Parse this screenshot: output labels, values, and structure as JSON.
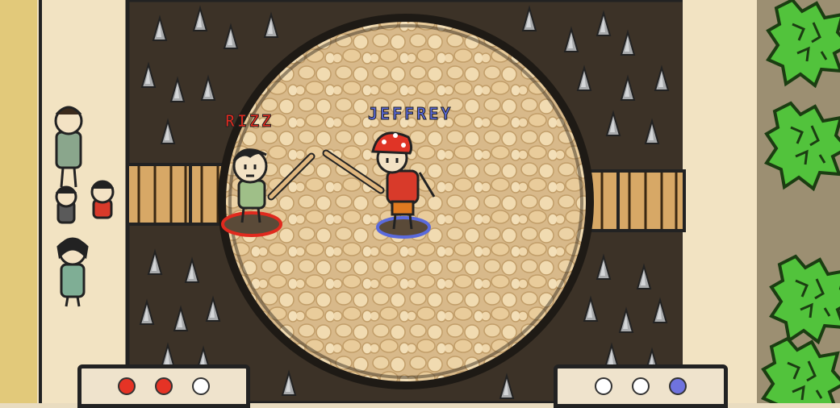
{
  "fighters": {
    "left": {
      "name": "RIZZ",
      "color": "#e02a1e"
    },
    "right": {
      "name": "JEFFREY",
      "color": "#5a6adc"
    }
  },
  "score_left": {
    "dots": [
      "#e53325",
      "#e53325",
      "#ffffff"
    ]
  },
  "score_right": {
    "dots": [
      "#ffffff",
      "#ffffff",
      "#6f73de"
    ]
  },
  "colors": {
    "sand": "#f2e3c2",
    "pit": "#3c3227",
    "arena_floor": "#e0c394",
    "bushes": "#4fc03a"
  },
  "icons": {
    "spikes": "spike-icon",
    "bridges": "bridge-icon",
    "trees": "bush-icon"
  }
}
